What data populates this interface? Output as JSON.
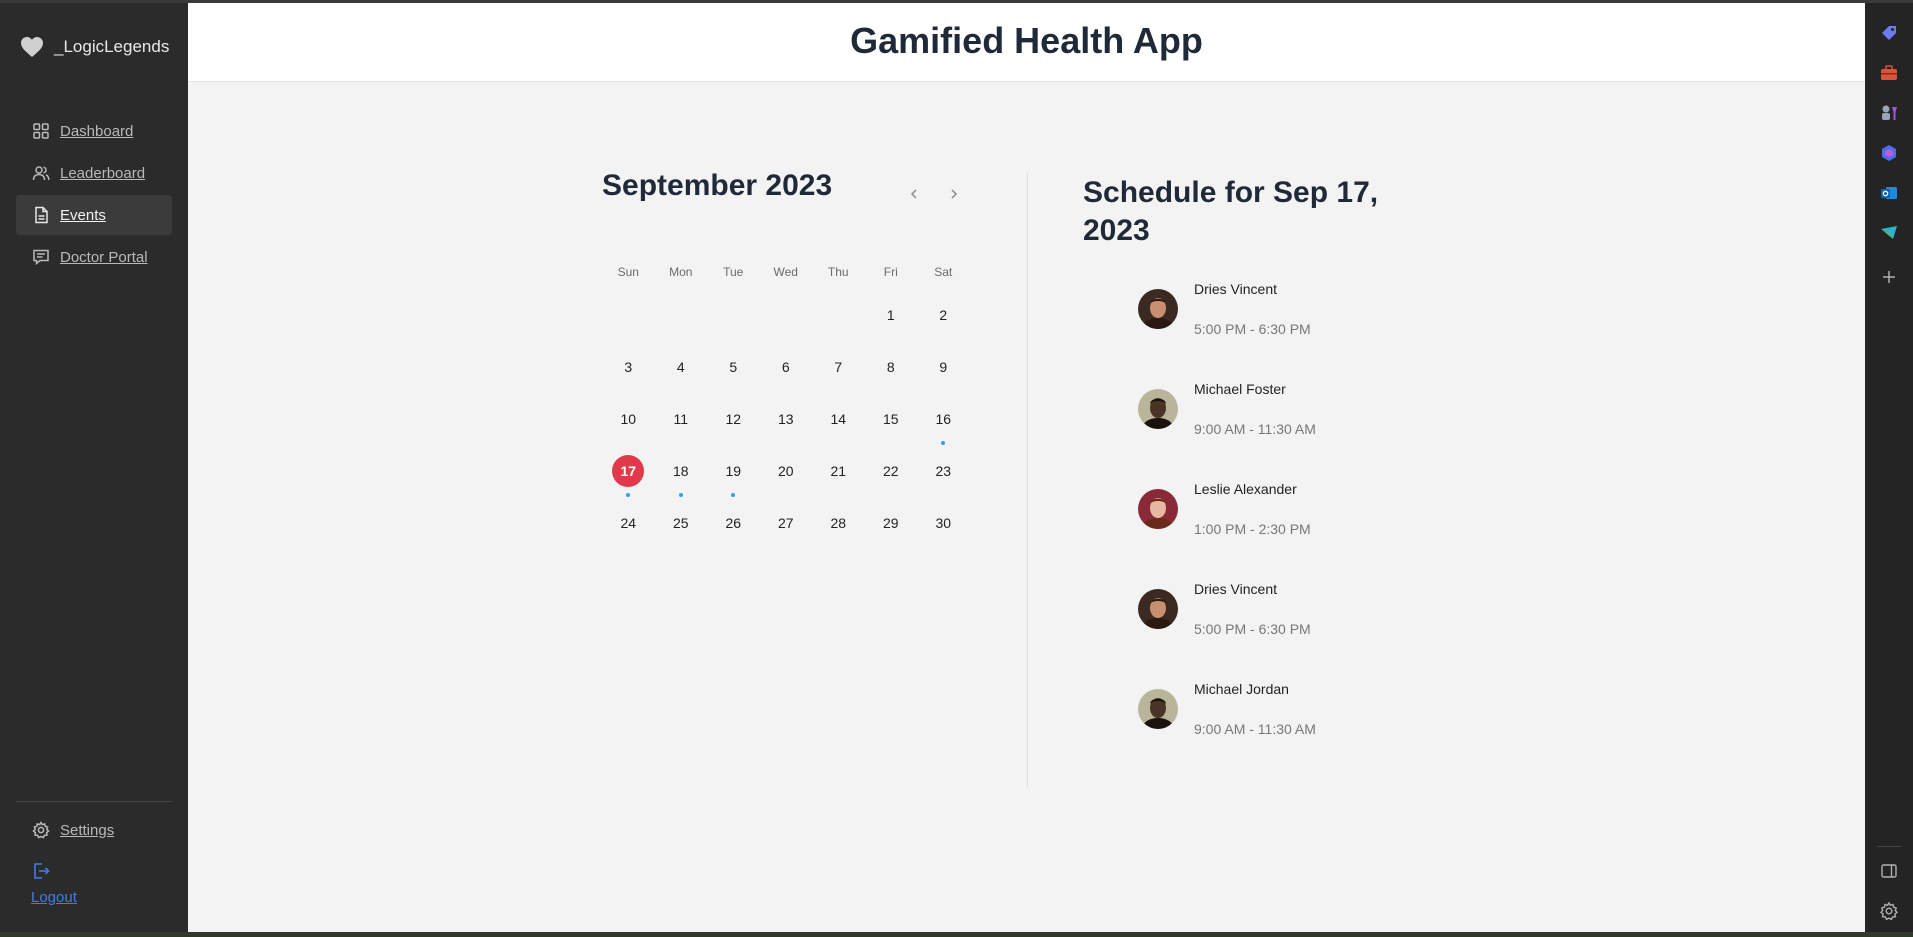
{
  "brand": {
    "name": "_LogicLegends",
    "icon": "heart-icon"
  },
  "sidebar": {
    "items": [
      {
        "label": "Dashboard",
        "icon": "grid-icon"
      },
      {
        "label": "Leaderboard",
        "icon": "users-icon"
      },
      {
        "label": "Events",
        "icon": "document-icon",
        "active": true
      },
      {
        "label": "Doctor Portal",
        "icon": "chat-icon"
      }
    ],
    "settings_label": "Settings",
    "logout_label": "Logout"
  },
  "header": {
    "title": "Gamified Health App"
  },
  "calendar": {
    "month_title": "September 2023",
    "weekdays": [
      "Sun",
      "Mon",
      "Tue",
      "Wed",
      "Thu",
      "Fri",
      "Sat"
    ],
    "leading_blanks": 5,
    "days": [
      "1",
      "2",
      "3",
      "4",
      "5",
      "6",
      "7",
      "8",
      "9",
      "10",
      "11",
      "12",
      "13",
      "14",
      "15",
      "16",
      "17",
      "18",
      "19",
      "20",
      "21",
      "22",
      "23",
      "24",
      "25",
      "26",
      "27",
      "28",
      "29",
      "30"
    ],
    "selected_day": "17",
    "event_days": [
      "16",
      "17",
      "18",
      "19"
    ]
  },
  "schedule": {
    "title": "Schedule for Sep 17, 2023",
    "events": [
      {
        "name": "Dries Vincent",
        "time": "5:00 PM - 6:30 PM"
      },
      {
        "name": "Michael Foster",
        "time": "9:00 AM - 11:30 AM"
      },
      {
        "name": "Leslie Alexander",
        "time": "1:00 PM - 2:30 PM"
      },
      {
        "name": "Dries Vincent",
        "time": "5:00 PM - 6:30 PM"
      },
      {
        "name": "Michael Jordan",
        "time": "9:00 AM - 11:30 AM"
      }
    ]
  },
  "colors": {
    "accent": "#e0394b",
    "event_dot": "#2ea4e8",
    "link": "#3d7de8"
  }
}
